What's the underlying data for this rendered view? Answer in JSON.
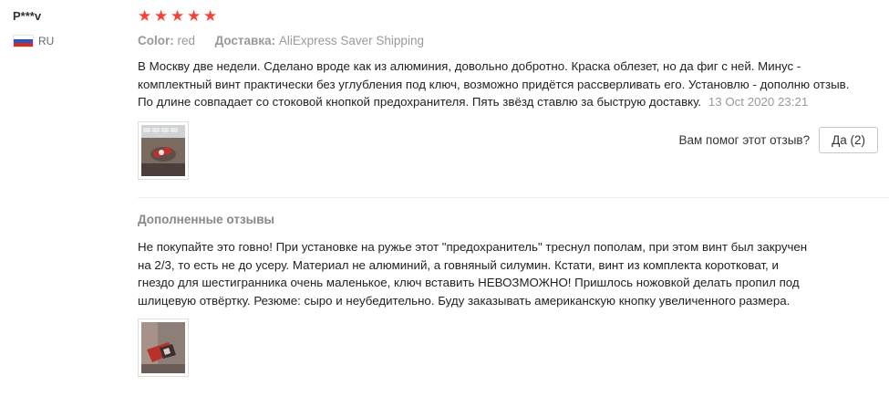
{
  "user": {
    "name": "P***v",
    "country": "RU",
    "flag_colors": [
      "#ffffff",
      "#2b55c7",
      "#d52b1e"
    ]
  },
  "review": {
    "rating": 5,
    "star_color": "#f44336",
    "color_label": "Color:",
    "color_value": "red",
    "delivery_label": "Доставка:",
    "delivery_value": "AliExpress Saver Shipping",
    "text": "В Москву две недели. Сделано вроде как из алюминия, довольно добротно. Краска облезет, но да фиг с ней. Минус - комплектный винт практически без углубления под ключ, возможно придётся рассверливать его. Установлю - дополню отзыв. По длине совпадает со стоковой кнопкой предохранителя. Пять звёзд ставлю за быструю доставку.",
    "date": "13 Oct 2020 23:21",
    "photo_icon": "review-photo"
  },
  "helpful": {
    "question": "Вам помог этот отзыв?",
    "button_label": "Да (2)"
  },
  "additional": {
    "title": "Дополненные отзывы",
    "text": "Не покупайте это говно! При установке на ружье этот \"предохранитель\" треснул пополам, при этом винт был закручен на 2/3, то есть не до усеру. Материал не алюминий, а говняный силумин. Кстати, винт из комплекта коротковат, и гнездо для шестигранника очень маленькое, ключ вставить НЕВОЗМОЖНО! Пришлось ножовкой делать пропил под шлицевую отвёртку. Резюме: сыро и неубедительно. Буду заказывать американскую кнопку увеличенного размера.",
    "photo_icon": "review-photo"
  }
}
